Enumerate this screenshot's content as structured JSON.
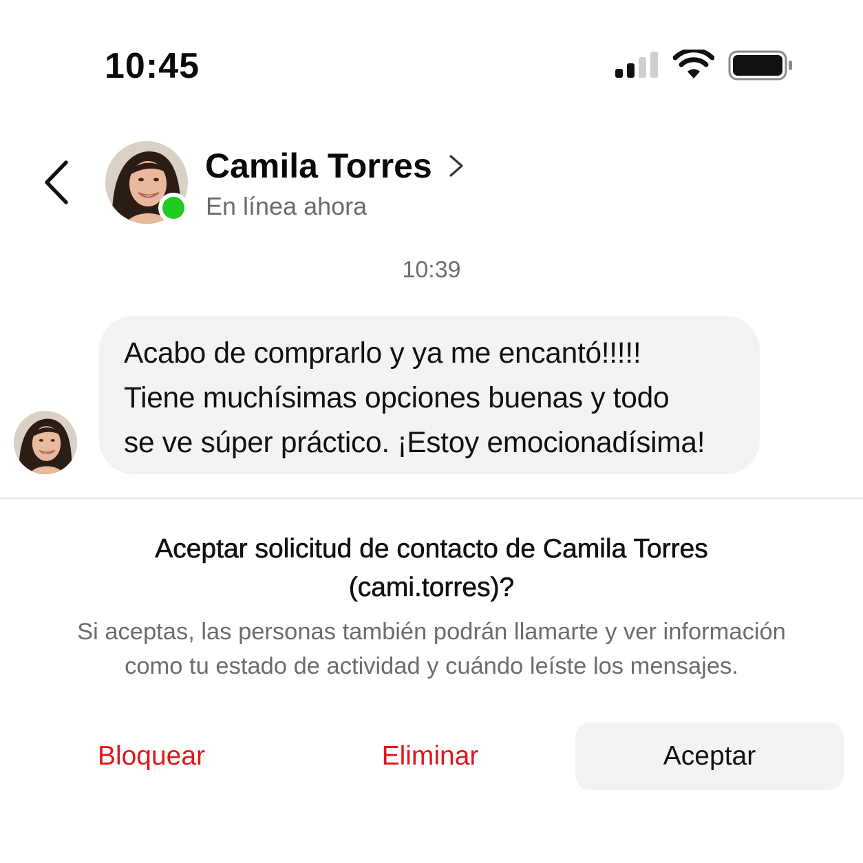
{
  "status_bar": {
    "time": "10:45",
    "signal_icon": "cellular-signal-icon",
    "wifi_icon": "wifi-icon",
    "battery_icon": "battery-icon"
  },
  "header": {
    "back_icon": "chevron-left-icon",
    "contact_name": "Camila Torres",
    "name_chevron_icon": "chevron-right-icon",
    "status": "En línea ahora",
    "online_color": "#1fcc1f"
  },
  "chat": {
    "timestamp": "10:39",
    "messages": [
      {
        "lines": [
          "Acabo de comprarlo y ya me encantó!!!!!",
          "Tiene muchísimas opciones buenas y todo",
          "se ve súper práctico. ¡Estoy emocionadísima!"
        ]
      }
    ]
  },
  "request": {
    "title_line1": "Aceptar solicitud de contacto de Camila Torres",
    "title_line2": "(cami.torres)?",
    "desc_line1": "Si aceptas, las personas también podrán llamarte y ver información",
    "desc_line2": "como tu estado de actividad y cuándo leíste los mensajes."
  },
  "actions": {
    "block": "Bloquear",
    "delete": "Eliminar",
    "accept": "Aceptar",
    "danger_color": "#e0161b"
  }
}
